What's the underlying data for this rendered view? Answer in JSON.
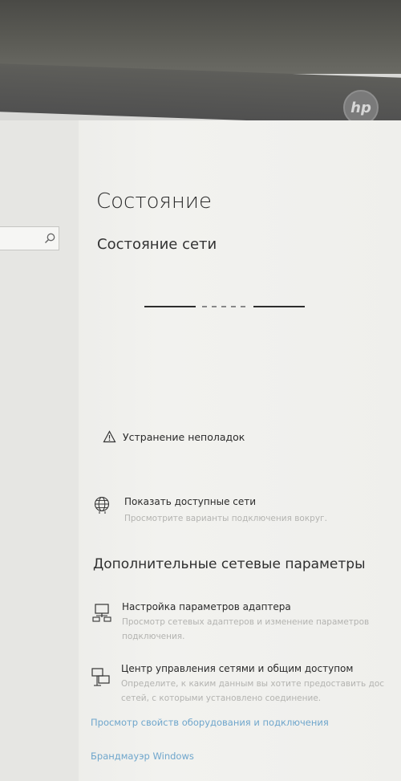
{
  "bezel": {
    "logo_text": "hp"
  },
  "search": {
    "placeholder": ""
  },
  "page": {
    "title": "Состояние",
    "subtitle": "Состояние сети"
  },
  "troubleshoot": {
    "label": "Устранение неполадок",
    "icon": "warning-triangle-icon"
  },
  "show_networks": {
    "label": "Показать доступные сети",
    "description": "Просмотрите варианты подключения вокруг.",
    "icon": "globe-icon"
  },
  "advanced": {
    "heading": "Дополнительные сетевые параметры",
    "adapter": {
      "label": "Настройка параметров адаптера",
      "description_line1": "Просмотр сетевых адаптеров и изменение параметров",
      "description_line2": "подключения.",
      "icon": "network-adapter-icon"
    },
    "sharing_center": {
      "label": "Центр управления сетями и общим доступом",
      "description_line1": "Определите, к каким данным вы хотите предоставить дос",
      "description_line2": "сетей, с которыми установлено соединение.",
      "icon": "network-sharing-icon"
    },
    "links": [
      "Просмотр свойств оборудования и подключения",
      "Брандмауэр Windows"
    ]
  },
  "colors": {
    "link_blue": "#6fa6cc",
    "text_dark": "#2b2b2b",
    "desc_gray": "#b3b3b0"
  }
}
